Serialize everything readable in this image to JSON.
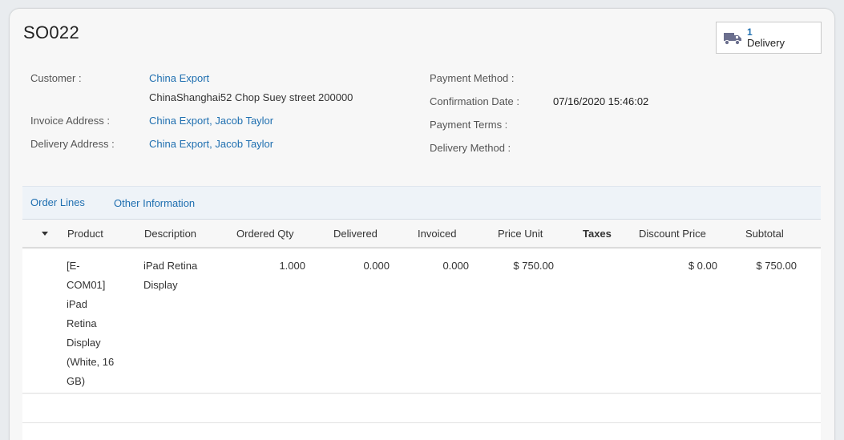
{
  "order": {
    "name": "SO022"
  },
  "smart_button": {
    "count": "1",
    "label": "Delivery",
    "icon": "truck-icon"
  },
  "fields_left": {
    "customer_label": "Customer :",
    "customer_value": "China Export",
    "customer_address": "ChinaShanghai52 Chop Suey street 200000",
    "invoice_label": "Invoice Address :",
    "invoice_value": "China Export, Jacob Taylor",
    "delivery_label": "Delivery Address :",
    "delivery_value": "China Export, Jacob Taylor"
  },
  "fields_right": {
    "payment_method_label": "Payment Method :",
    "confirmation_label": "Confirmation Date :",
    "confirmation_value": "07/16/2020 15:46:02",
    "payment_terms_label": "Payment Terms :",
    "delivery_method_label": "Delivery Method :"
  },
  "tabs": [
    {
      "label": "Order Lines",
      "active": true
    },
    {
      "label": "Other Information",
      "active": false
    }
  ],
  "table": {
    "columns": [
      "Product",
      "Description",
      "Ordered Qty",
      "Delivered",
      "Invoiced",
      "Price Unit",
      "Taxes",
      "Discount Price",
      "Subtotal"
    ],
    "rows": [
      {
        "product_lines": [
          "[E-",
          "COM01]",
          "iPad",
          "Retina",
          "Display",
          "(White, 16",
          "GB)"
        ],
        "description_lines": [
          "iPad Retina",
          "Display"
        ],
        "ordered_qty": "1.000",
        "delivered": "0.000",
        "invoiced": "0.000",
        "price_unit": "$ 750.00",
        "taxes": "",
        "discount_price": "$ 0.00",
        "subtotal": "$ 750.00"
      }
    ]
  },
  "colors": {
    "link": "#1f6fb0",
    "tab_bar": "#eef3f8",
    "truck_icon": "#6b6f8e"
  }
}
